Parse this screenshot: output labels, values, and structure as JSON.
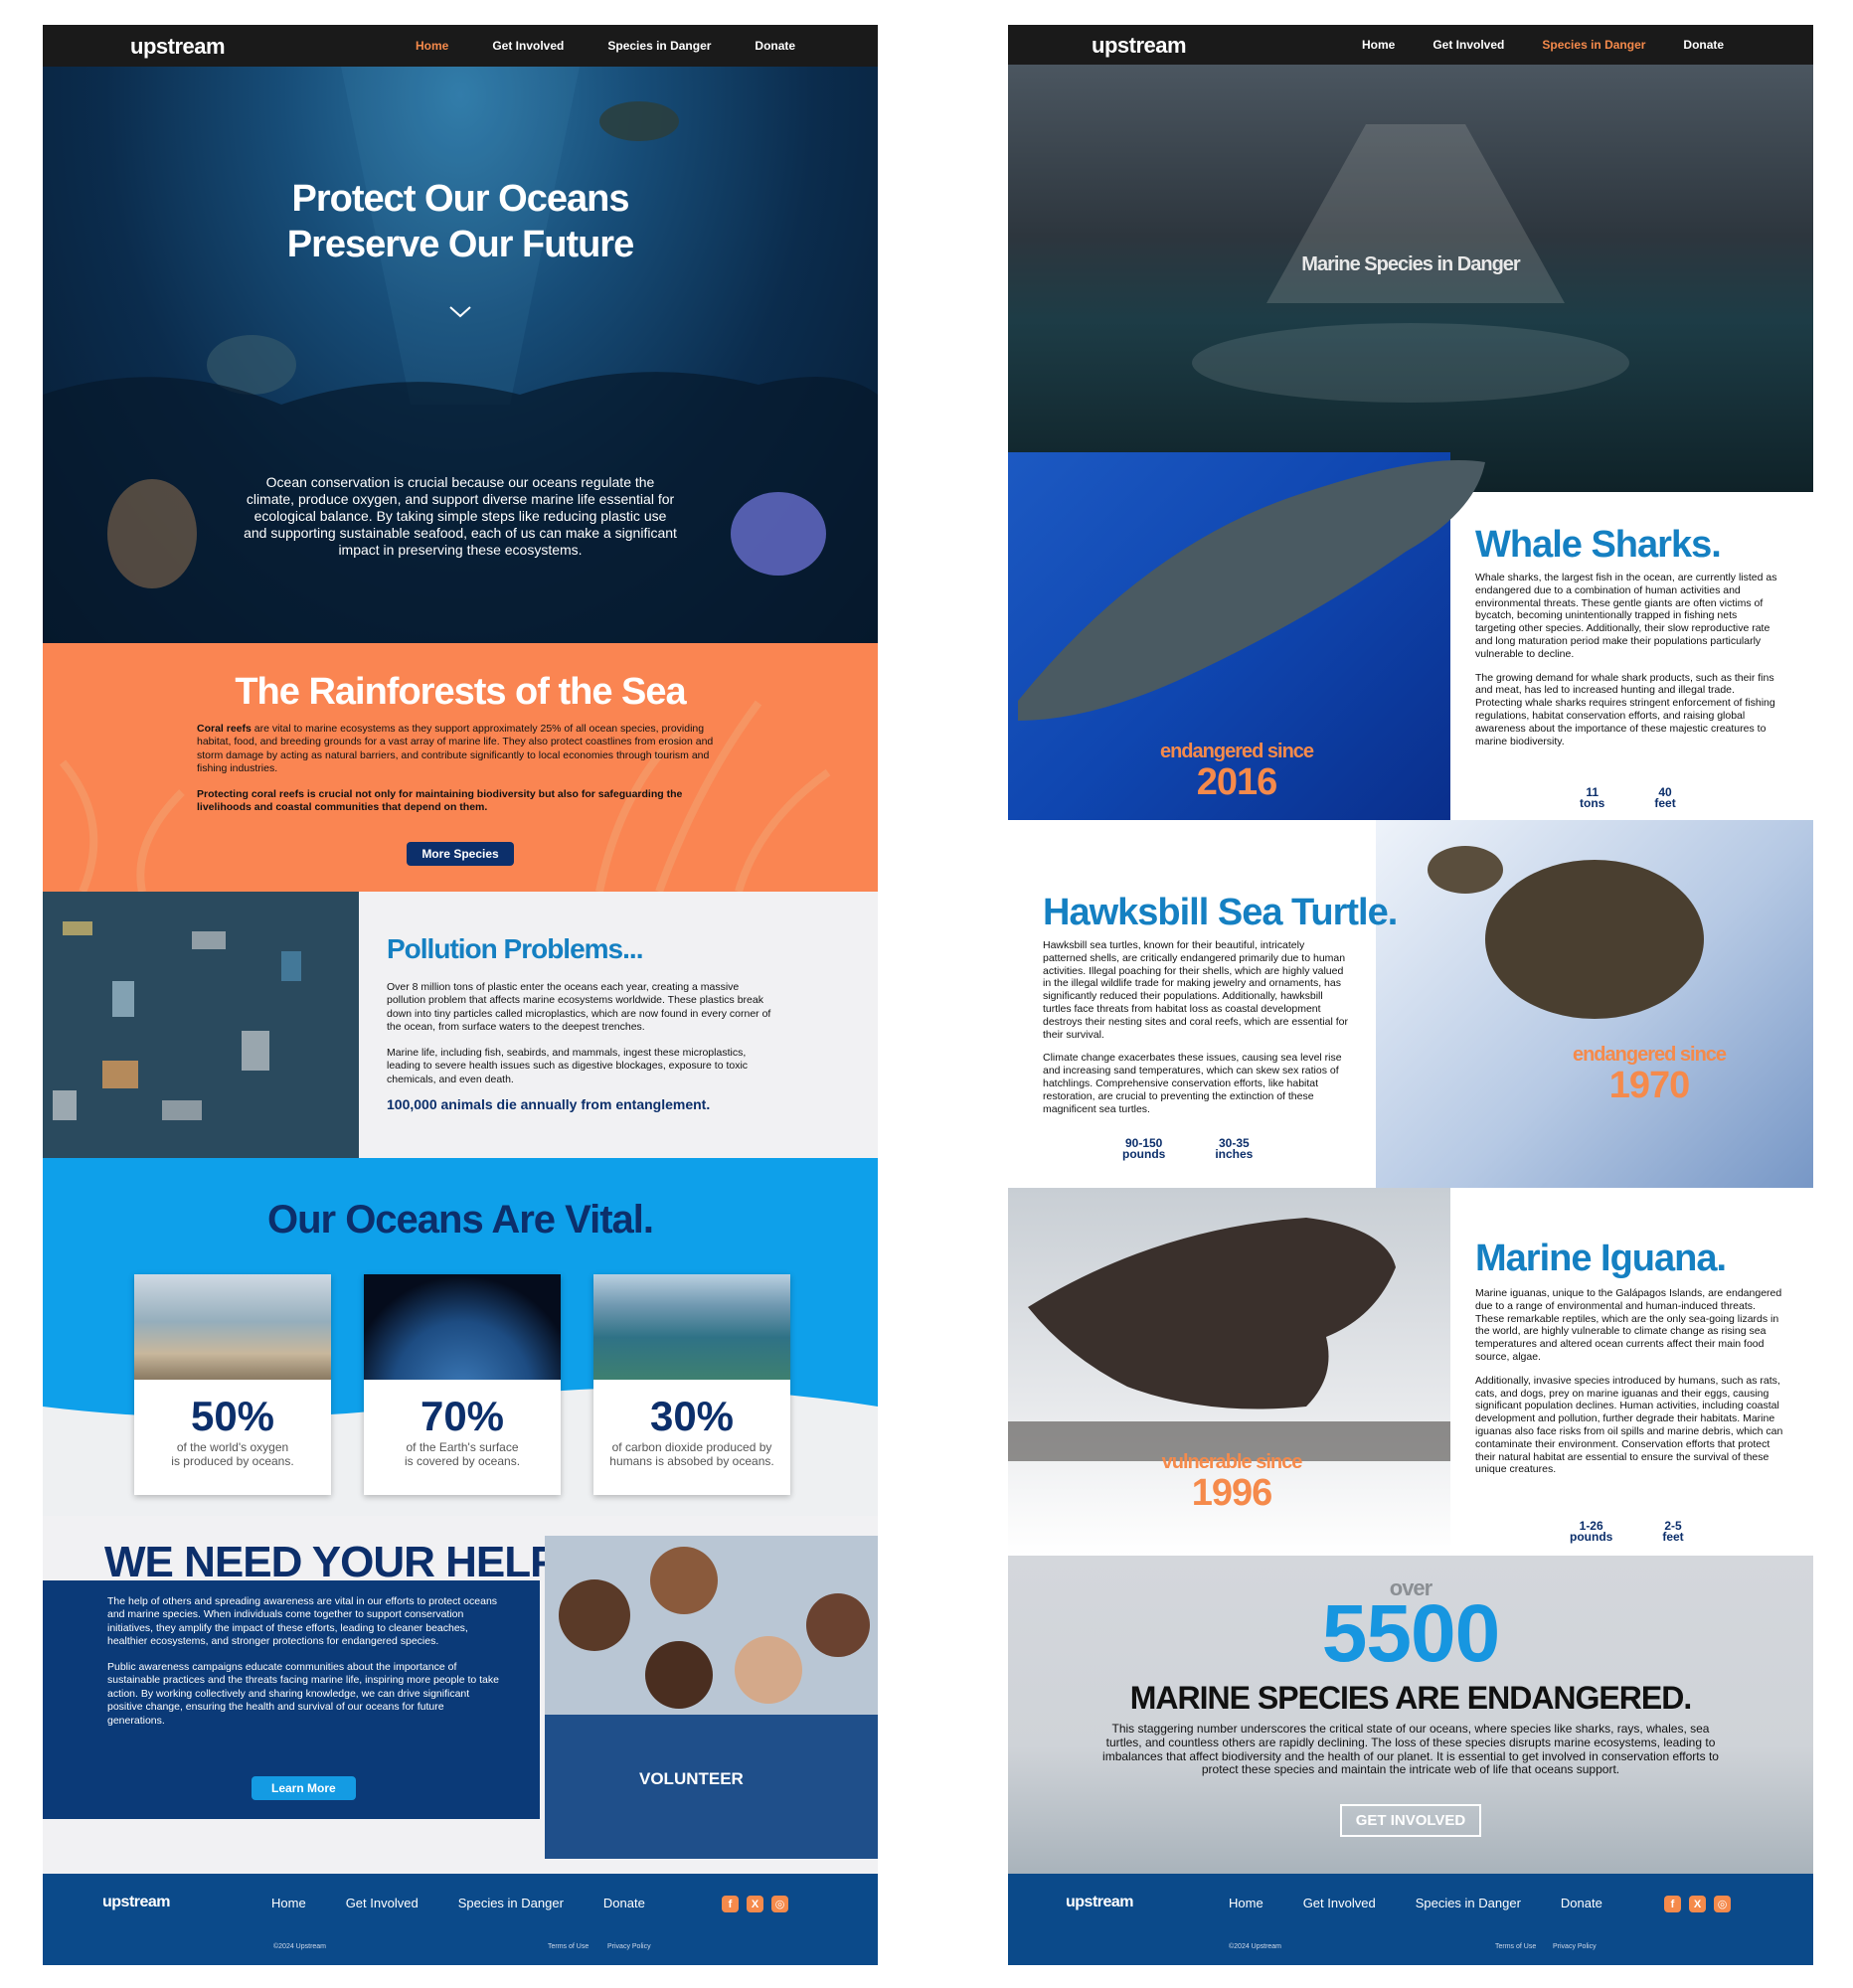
{
  "brand": "upstream",
  "nav": {
    "home": "Home",
    "involved": "Get Involved",
    "species": "Species in Danger",
    "donate": "Donate"
  },
  "home": {
    "hero": {
      "title1": "Protect Our Oceans",
      "title2": "Preserve Our Future",
      "body": "Ocean conservation is crucial because our oceans regulate the climate, produce oxygen, and support diverse marine life essential for ecological balance. By taking simple steps like reducing plastic use and supporting sustainable seafood, each of us can make a significant impact in preserving these ecosystems."
    },
    "reef": {
      "title": "The Rainforests of the Sea",
      "p1_bold": "Coral reefs",
      "p1": " are vital to marine ecosystems as they support approximately 25% of all ocean species, providing habitat, food, and breeding grounds for a vast array of marine life. They also protect coastlines from erosion and storm damage by acting as natural barriers, and contribute significantly to local economies through tourism and fishing industries.",
      "p2": "Protecting coral reefs is crucial not only for maintaining biodiversity but also for safeguarding the livelihoods and coastal communities that depend on them.",
      "button": "More Species"
    },
    "pollution": {
      "title": "Pollution Problems...",
      "p1": "Over 8 million tons of plastic enter the oceans each year, creating a massive pollution problem that affects marine ecosystems worldwide. These plastics break down into tiny particles called microplastics, which are now found in every corner of the ocean, from surface waters to the deepest trenches.",
      "p2": "Marine life, including fish, seabirds, and mammals, ingest these microplastics, leading to severe health issues such as digestive blockages, exposure to toxic chemicals, and even death.",
      "highlight": "100,000 animals die annually from entanglement."
    },
    "vital": {
      "title": "Our Oceans Are Vital.",
      "stats": [
        {
          "value": "50%",
          "line1": "of the world's oxygen",
          "line2": "is produced by oceans."
        },
        {
          "value": "70%",
          "line1": "of the Earth's surface",
          "line2": "is covered by oceans."
        },
        {
          "value": "30%",
          "line1": "of carbon dioxide produced by",
          "line2": "humans is absobed by oceans."
        }
      ]
    },
    "help": {
      "title": "WE NEED YOUR HELP",
      "p1": "The help of others and spreading awareness are vital in our efforts to protect oceans and marine species. When individuals come together to support conservation initiatives, they amplify the impact of these efforts, leading to cleaner beaches, healthier ecosystems, and stronger protections for endangered species.",
      "p2": "Public awareness campaigns educate communities about the importance of sustainable practices and the threats facing marine life, inspiring more people to take action. By working collectively and sharing knowledge, we can drive significant positive change, ensuring the health and survival of our oceans for future generations.",
      "button": "Learn More",
      "shirt": "VOLUNTEER"
    }
  },
  "species_page": {
    "hero_title": "Marine Species in Danger",
    "whale": {
      "title": "Whale Sharks.",
      "p1": "Whale sharks, the largest fish in the ocean, are currently listed as endangered due to a combination of human activities and environmental threats. These gentle giants are often victims of bycatch, becoming unintentionally trapped in fishing nets targeting other species. Additionally, their slow reproductive rate and long maturation period make their populations particularly vulnerable to decline.",
      "p2": "The growing demand for whale shark products, such as their fins and meat, has led to increased hunting and illegal trade. Protecting whale sharks requires stringent enforcement of fishing regulations, habitat conservation efforts, and raising global awareness about the importance of these majestic creatures to marine biodiversity.",
      "status": "endangered since",
      "year": "2016",
      "stat1a": "11",
      "stat1b": "tons",
      "stat2a": "40",
      "stat2b": "feet"
    },
    "turtle": {
      "title": "Hawksbill Sea Turtle.",
      "p1": "Hawksbill sea turtles, known for their beautiful, intricately patterned shells, are critically endangered primarily due to human activities. Illegal poaching for their shells, which are highly valued in the illegal wildlife trade for making jewelry and ornaments, has significantly reduced their populations. Additionally, hawksbill turtles face threats from habitat loss as coastal development destroys their nesting sites and coral reefs, which are essential for their survival.",
      "p2": "Climate change exacerbates these issues, causing sea level rise and increasing sand temperatures, which can skew sex ratios of hatchlings. Comprehensive conservation efforts, like habitat restoration, are crucial to preventing the extinction of these magnificent sea turtles.",
      "status": "endangered since",
      "year": "1970",
      "stat1a": "90-150",
      "stat1b": "pounds",
      "stat2a": "30-35",
      "stat2b": "inches"
    },
    "iguana": {
      "title": "Marine Iguana.",
      "p1": "Marine iguanas, unique to the Galápagos Islands, are endangered due to a range of environmental and human-induced threats. These remarkable reptiles, which are the only sea-going lizards in the world, are highly vulnerable to climate change as rising sea temperatures and altered ocean currents affect their main food source, algae.",
      "p2": "Additionally, invasive species introduced by humans, such as rats, cats, and dogs, prey on marine iguanas and their eggs, causing significant population declines. Human activities, including coastal development and pollution, further degrade their habitats. Marine iguanas also face risks from oil spills and marine debris, which can contaminate their environment. Conservation efforts that protect their natural habitat are essential to ensure the survival of these unique creatures.",
      "status": "vulnerable since",
      "year": "1996",
      "stat1a": "1-26",
      "stat1b": "pounds",
      "stat2a": "2-5",
      "stat2b": "feet"
    },
    "count": {
      "over": "over",
      "number": "5500",
      "headline": "MARINE SPECIES ARE ENDANGERED.",
      "body": "This staggering number underscores the critical state of our oceans, where species like sharks, rays, whales, sea turtles, and countless others are rapidly declining. The loss of these species disrupts marine ecosystems, leading to imbalances that affect biodiversity and the health of our planet. It is essential to get involved in conservation efforts to protect these species and maintain the intricate web of life that oceans support.",
      "button": "GET INVOLVED"
    }
  },
  "footer": {
    "home": "Home",
    "involved": "Get Involved",
    "species": "Species in Danger",
    "donate": "Donate",
    "copyright": "©2024 Upstream",
    "terms": "Terms of Use",
    "privacy": "Privacy Policy"
  },
  "colors": {
    "orange": "#f58a4b",
    "navy": "#0c2f6b",
    "blue": "#1580c2",
    "bright_blue": "#149be3",
    "footer": "#0b4a8a"
  },
  "icons": [
    "chevron-down-icon",
    "facebook-icon",
    "x-icon",
    "instagram-icon"
  ]
}
